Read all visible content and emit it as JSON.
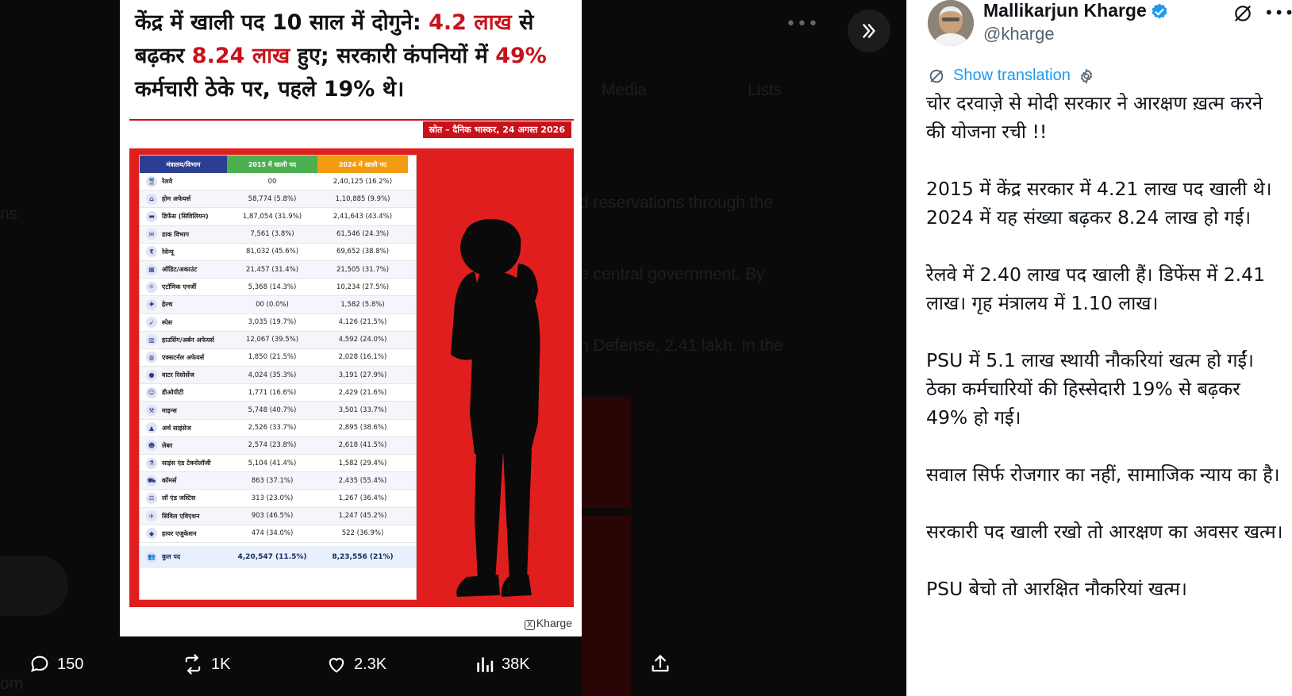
{
  "viewer": {
    "background_text": {
      "tab_media": "Media",
      "tab_lists": "Lists",
      "line1": "d reservations through the",
      "line2": "e central government. By",
      "line3": "n Defense, 2.41 lakh. In the",
      "edge1": "ns",
      "edge2": "om"
    },
    "card": {
      "headline_1": "केंद्र में खाली पद 10 साल में दोगुने: ",
      "headline_2": "4.2 लाख",
      "headline_3": " से बढ़कर ",
      "headline_4": "8.24 लाख",
      "headline_5": " हुए; सरकारी कंपनियों में ",
      "headline_6": "49%",
      "headline_7": " कर्मचारी ठेके पर, पहले 19% थे।",
      "source": "स्रोत – दैनिक भास्कर, 24 अगस्त 2026",
      "watermark": "Kharge",
      "table": {
        "headers": [
          "मंत्रालय/विभाग",
          "2015 में खाली पद",
          "2024 में खाली पद"
        ],
        "rows": [
          {
            "icon": "train-icon",
            "glyph": "🚆",
            "name": "रेलवे",
            "y2015": "00",
            "y2024": "2,40,125 (16.2%)"
          },
          {
            "icon": "home-icon",
            "glyph": "⌂",
            "name": "होम अफेयर्स",
            "y2015": "58,774 (5.8%)",
            "y2024": "1,10,885 (9.9%)"
          },
          {
            "icon": "tank-icon",
            "glyph": "▬",
            "name": "डिफेंस (सिविलियन)",
            "y2015": "1,87,054 (31.9%)",
            "y2024": "2,41,643 (43.4%)"
          },
          {
            "icon": "mail-icon",
            "glyph": "✉",
            "name": "डाक विभाग",
            "y2015": "7,561 (3.8%)",
            "y2024": "61,546 (24.3%)"
          },
          {
            "icon": "revenue-icon",
            "glyph": "₹",
            "name": "रेवेन्यू",
            "y2015": "81,032 (45.6%)",
            "y2024": "69,652 (38.8%)"
          },
          {
            "icon": "calculator-icon",
            "glyph": "▦",
            "name": "ऑडिट/अकाउंट",
            "y2015": "21,457 (31.4%)",
            "y2024": "21,505 (31.7%)"
          },
          {
            "icon": "atom-icon",
            "glyph": "⚛",
            "name": "एटॉमिक एनर्जी",
            "y2015": "5,368 (14.3%)",
            "y2024": "10,234 (27.5%)"
          },
          {
            "icon": "health-icon",
            "glyph": "✚",
            "name": "हेल्थ",
            "y2015": "00 (0.0%)",
            "y2024": "1,582 (5.8%)"
          },
          {
            "icon": "rocket-icon",
            "glyph": "➶",
            "name": "स्पेस",
            "y2015": "3,035 (19.7%)",
            "y2024": "4,126 (21.5%)"
          },
          {
            "icon": "building-icon",
            "glyph": "▥",
            "name": "हाउसिंग/अर्बन अफेयर्स",
            "y2015": "12,067 (39.5%)",
            "y2024": "4,592 (24.0%)"
          },
          {
            "icon": "globe-icon",
            "glyph": "◍",
            "name": "एक्सटर्नल अफेयर्स",
            "y2015": "1,850 (21.5%)",
            "y2024": "2,028 (16.1%)"
          },
          {
            "icon": "water-drop-icon",
            "glyph": "●",
            "name": "वाटर रिसोर्सेज",
            "y2015": "4,024 (35.3%)",
            "y2024": "3,191 (27.9%)"
          },
          {
            "icon": "person-icon",
            "glyph": "☺",
            "name": "डीओपीटी",
            "y2015": "1,771 (16.6%)",
            "y2024": "2,429 (21.6%)"
          },
          {
            "icon": "pickaxe-icon",
            "glyph": "⚒",
            "name": "माइन्स",
            "y2015": "5,748 (40.7%)",
            "y2024": "3,501 (33.7%)"
          },
          {
            "icon": "mountain-icon",
            "glyph": "▲",
            "name": "अर्थ साइंसेज",
            "y2015": "2,526 (33.7%)",
            "y2024": "2,895 (38.6%)"
          },
          {
            "icon": "worker-icon",
            "glyph": "☻",
            "name": "लेबर",
            "y2015": "2,574 (23.8%)",
            "y2024": "2,618 (41.5%)"
          },
          {
            "icon": "flask-icon",
            "glyph": "⚗",
            "name": "साइंस एंड टेक्नोलॉजी",
            "y2015": "5,104 (41.4%)",
            "y2024": "1,582 (29.4%)"
          },
          {
            "icon": "cart-icon",
            "glyph": "⛟",
            "name": "कॉमर्स",
            "y2015": "863 (37.1%)",
            "y2024": "2,435 (55.4%)"
          },
          {
            "icon": "scales-icon",
            "glyph": "⚖",
            "name": "लॉ एंड जस्टिस",
            "y2015": "313 (23.0%)",
            "y2024": "1,267 (36.4%)"
          },
          {
            "icon": "plane-icon",
            "glyph": "✈",
            "name": "सिविल एविएशन",
            "y2015": "903 (46.5%)",
            "y2024": "1,247 (45.2%)"
          },
          {
            "icon": "graduation-cap-icon",
            "glyph": "◆",
            "name": "हायर एजुकेशन",
            "y2015": "474 (34.0%)",
            "y2024": "522 (36.9%)"
          }
        ],
        "total": {
          "icon": "people-icon",
          "glyph": "👥",
          "name": "कुल पद",
          "y2015": "4,20,547 (11.5%)",
          "y2024": "8,23,556 (21%)"
        }
      }
    },
    "actions": {
      "replies": "150",
      "reposts": "1K",
      "likes": "2.3K",
      "views": "38K"
    }
  },
  "sidebar": {
    "author_name": "Mallikarjun Kharge",
    "handle": "@kharge",
    "show_translation": "Show translation",
    "paragraphs": [
      "चोर दरवाज़े से मोदी सरकार ने आरक्षण ख़त्म करने की योजना रची !!",
      "2015 में केंद्र सरकार में 4.21 लाख पद खाली थे। 2024 में यह संख्या बढ़कर 8.24 लाख हो गई।",
      "रेलवे में 2.40 लाख पद खाली हैं। डिफेंस में 2.41 लाख। गृह मंत्रालय में 1.10 लाख।",
      "PSU में 5.1 लाख स्थायी नौकरियां खत्म हो गईं। ठेका कर्मचारियों की हिस्सेदारी 19% से बढ़कर 49% हो गई।",
      "सवाल सिर्फ रोजगार का नहीं, सामाजिक न्याय का है।",
      "सरकारी पद खाली रखो तो आरक्षण का अवसर खत्म।",
      "PSU बेचो तो आरक्षित नौकरियां खत्म।"
    ]
  },
  "colors": {
    "accent_red": "#c8121b",
    "link_blue": "#1d9bf0",
    "verified_blue": "#1d9bf0"
  }
}
